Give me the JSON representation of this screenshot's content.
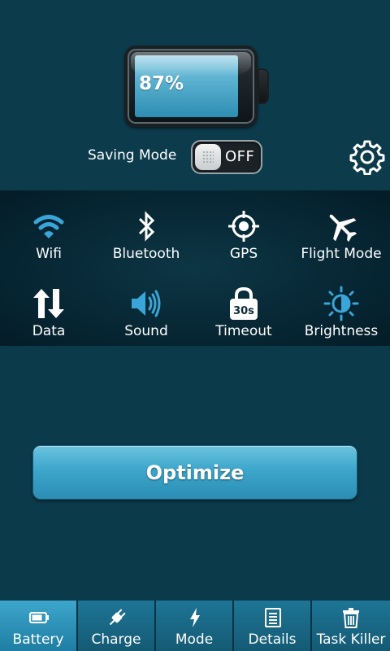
{
  "battery": {
    "percent_text": "87%",
    "level": 0.87
  },
  "saving_mode": {
    "label": "Saving Mode",
    "state_text": "OFF"
  },
  "settings": {
    "icon": "gear-icon"
  },
  "toggles": [
    {
      "label": "Wifi",
      "icon": "wifi-icon",
      "active": true
    },
    {
      "label": "Bluetooth",
      "icon": "bluetooth-icon",
      "active": false
    },
    {
      "label": "GPS",
      "icon": "gps-icon",
      "active": false
    },
    {
      "label": "Flight Mode",
      "icon": "airplane-icon",
      "active": false
    },
    {
      "label": "Data",
      "icon": "data-arrows-icon",
      "active": false
    },
    {
      "label": "Sound",
      "icon": "speaker-icon",
      "active": true
    },
    {
      "label": "Timeout",
      "icon": "timeout-lock-icon",
      "badge": "30s",
      "active": false
    },
    {
      "label": "Brightness",
      "icon": "brightness-icon",
      "active": true
    }
  ],
  "optimize": {
    "label": "Optimize"
  },
  "nav": [
    {
      "label": "Battery",
      "icon": "battery-icon",
      "active": true
    },
    {
      "label": "Charge",
      "icon": "plug-icon",
      "active": false
    },
    {
      "label": "Mode",
      "icon": "lightning-icon",
      "active": false
    },
    {
      "label": "Details",
      "icon": "document-icon",
      "active": false
    },
    {
      "label": "Task Killer",
      "icon": "trash-icon",
      "active": false
    }
  ],
  "colors": {
    "accent": "#3aa5d8",
    "background": "#0b3a4b",
    "panel": "#062431"
  }
}
